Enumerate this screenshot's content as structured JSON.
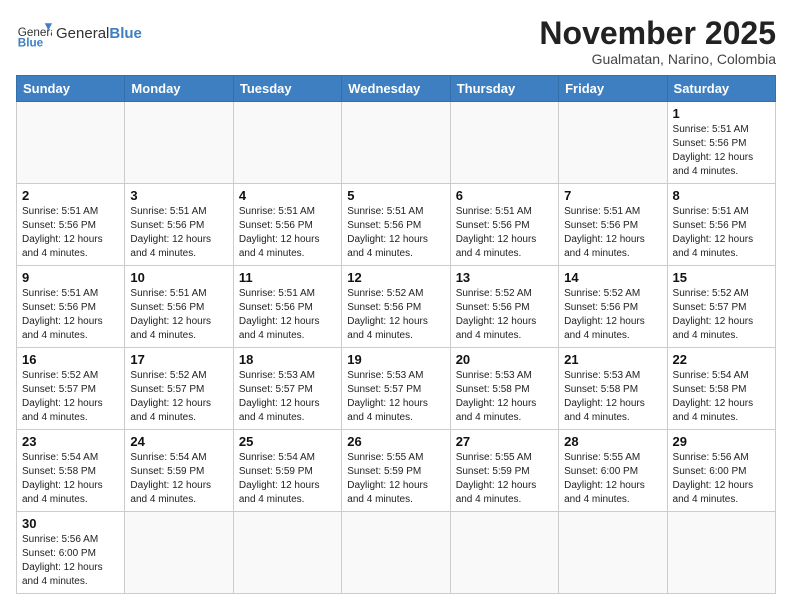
{
  "header": {
    "logo_general": "General",
    "logo_blue": "Blue",
    "month_title": "November 2025",
    "subtitle": "Gualmatan, Narino, Colombia"
  },
  "days_of_week": [
    "Sunday",
    "Monday",
    "Tuesday",
    "Wednesday",
    "Thursday",
    "Friday",
    "Saturday"
  ],
  "weeks": [
    {
      "days": [
        {
          "num": "",
          "info": ""
        },
        {
          "num": "",
          "info": ""
        },
        {
          "num": "",
          "info": ""
        },
        {
          "num": "",
          "info": ""
        },
        {
          "num": "",
          "info": ""
        },
        {
          "num": "",
          "info": ""
        },
        {
          "num": "1",
          "info": "Sunrise: 5:51 AM\nSunset: 5:56 PM\nDaylight: 12 hours and 4 minutes."
        }
      ]
    },
    {
      "days": [
        {
          "num": "2",
          "info": "Sunrise: 5:51 AM\nSunset: 5:56 PM\nDaylight: 12 hours and 4 minutes."
        },
        {
          "num": "3",
          "info": "Sunrise: 5:51 AM\nSunset: 5:56 PM\nDaylight: 12 hours and 4 minutes."
        },
        {
          "num": "4",
          "info": "Sunrise: 5:51 AM\nSunset: 5:56 PM\nDaylight: 12 hours and 4 minutes."
        },
        {
          "num": "5",
          "info": "Sunrise: 5:51 AM\nSunset: 5:56 PM\nDaylight: 12 hours and 4 minutes."
        },
        {
          "num": "6",
          "info": "Sunrise: 5:51 AM\nSunset: 5:56 PM\nDaylight: 12 hours and 4 minutes."
        },
        {
          "num": "7",
          "info": "Sunrise: 5:51 AM\nSunset: 5:56 PM\nDaylight: 12 hours and 4 minutes."
        },
        {
          "num": "8",
          "info": "Sunrise: 5:51 AM\nSunset: 5:56 PM\nDaylight: 12 hours and 4 minutes."
        }
      ]
    },
    {
      "days": [
        {
          "num": "9",
          "info": "Sunrise: 5:51 AM\nSunset: 5:56 PM\nDaylight: 12 hours and 4 minutes."
        },
        {
          "num": "10",
          "info": "Sunrise: 5:51 AM\nSunset: 5:56 PM\nDaylight: 12 hours and 4 minutes."
        },
        {
          "num": "11",
          "info": "Sunrise: 5:51 AM\nSunset: 5:56 PM\nDaylight: 12 hours and 4 minutes."
        },
        {
          "num": "12",
          "info": "Sunrise: 5:52 AM\nSunset: 5:56 PM\nDaylight: 12 hours and 4 minutes."
        },
        {
          "num": "13",
          "info": "Sunrise: 5:52 AM\nSunset: 5:56 PM\nDaylight: 12 hours and 4 minutes."
        },
        {
          "num": "14",
          "info": "Sunrise: 5:52 AM\nSunset: 5:56 PM\nDaylight: 12 hours and 4 minutes."
        },
        {
          "num": "15",
          "info": "Sunrise: 5:52 AM\nSunset: 5:57 PM\nDaylight: 12 hours and 4 minutes."
        }
      ]
    },
    {
      "days": [
        {
          "num": "16",
          "info": "Sunrise: 5:52 AM\nSunset: 5:57 PM\nDaylight: 12 hours and 4 minutes."
        },
        {
          "num": "17",
          "info": "Sunrise: 5:52 AM\nSunset: 5:57 PM\nDaylight: 12 hours and 4 minutes."
        },
        {
          "num": "18",
          "info": "Sunrise: 5:53 AM\nSunset: 5:57 PM\nDaylight: 12 hours and 4 minutes."
        },
        {
          "num": "19",
          "info": "Sunrise: 5:53 AM\nSunset: 5:57 PM\nDaylight: 12 hours and 4 minutes."
        },
        {
          "num": "20",
          "info": "Sunrise: 5:53 AM\nSunset: 5:58 PM\nDaylight: 12 hours and 4 minutes."
        },
        {
          "num": "21",
          "info": "Sunrise: 5:53 AM\nSunset: 5:58 PM\nDaylight: 12 hours and 4 minutes."
        },
        {
          "num": "22",
          "info": "Sunrise: 5:54 AM\nSunset: 5:58 PM\nDaylight: 12 hours and 4 minutes."
        }
      ]
    },
    {
      "days": [
        {
          "num": "23",
          "info": "Sunrise: 5:54 AM\nSunset: 5:58 PM\nDaylight: 12 hours and 4 minutes."
        },
        {
          "num": "24",
          "info": "Sunrise: 5:54 AM\nSunset: 5:59 PM\nDaylight: 12 hours and 4 minutes."
        },
        {
          "num": "25",
          "info": "Sunrise: 5:54 AM\nSunset: 5:59 PM\nDaylight: 12 hours and 4 minutes."
        },
        {
          "num": "26",
          "info": "Sunrise: 5:55 AM\nSunset: 5:59 PM\nDaylight: 12 hours and 4 minutes."
        },
        {
          "num": "27",
          "info": "Sunrise: 5:55 AM\nSunset: 5:59 PM\nDaylight: 12 hours and 4 minutes."
        },
        {
          "num": "28",
          "info": "Sunrise: 5:55 AM\nSunset: 6:00 PM\nDaylight: 12 hours and 4 minutes."
        },
        {
          "num": "29",
          "info": "Sunrise: 5:56 AM\nSunset: 6:00 PM\nDaylight: 12 hours and 4 minutes."
        }
      ]
    },
    {
      "days": [
        {
          "num": "30",
          "info": "Sunrise: 5:56 AM\nSunset: 6:00 PM\nDaylight: 12 hours and 4 minutes."
        },
        {
          "num": "",
          "info": ""
        },
        {
          "num": "",
          "info": ""
        },
        {
          "num": "",
          "info": ""
        },
        {
          "num": "",
          "info": ""
        },
        {
          "num": "",
          "info": ""
        },
        {
          "num": "",
          "info": ""
        }
      ]
    }
  ]
}
